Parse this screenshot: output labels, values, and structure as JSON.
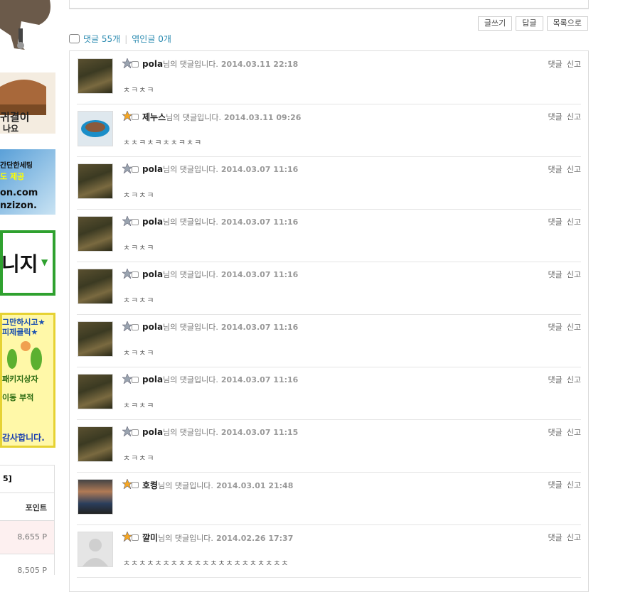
{
  "sidebar": {
    "banner2_text": "귀결이",
    "banner2_sub": "나요",
    "banner3_lines": [
      "간단한세팅",
      "도 제공",
      "on.com",
      "nzizon."
    ],
    "banner4_text": "니지",
    "banner5_lines": [
      "그만하시고★",
      "피제클릭★",
      "패키지상자",
      "이동 부적",
      "감사합니다."
    ],
    "rank_title": "5]",
    "rank_header": "포인트",
    "rank_values": [
      "8,655 P",
      "8,505 P"
    ]
  },
  "toolbar": {
    "write": "글쓰기",
    "reply": "답글",
    "list": "목록으로"
  },
  "comments_header": {
    "comments": "댓글 55개",
    "trackbacks": "엮인글 0개"
  },
  "comment_suffix": "님의 댓글입니다.",
  "comment_actions": {
    "reply": "댓글",
    "report": "신고"
  },
  "comments": [
    {
      "name": "pola",
      "date": "2014.03.11 22:18",
      "text": "ㅊㅋㅊㅋ",
      "avatar": "game"
    },
    {
      "name": "제누스",
      "date": "2014.03.11 09:26",
      "text": "ㅊㅊㅋㅊㅋㅊㅊㅋㅊㅋ",
      "avatar": "cup"
    },
    {
      "name": "pola",
      "date": "2014.03.07 11:16",
      "text": "ㅊㅋㅊㅋ",
      "avatar": "game"
    },
    {
      "name": "pola",
      "date": "2014.03.07 11:16",
      "text": "ㅊㅋㅊㅋ",
      "avatar": "game"
    },
    {
      "name": "pola",
      "date": "2014.03.07 11:16",
      "text": "ㅊㅋㅊㅋ",
      "avatar": "game"
    },
    {
      "name": "pola",
      "date": "2014.03.07 11:16",
      "text": "ㅊㅋㅊㅋ",
      "avatar": "game"
    },
    {
      "name": "pola",
      "date": "2014.03.07 11:16",
      "text": "ㅊㅋㅊㅋ",
      "avatar": "game"
    },
    {
      "name": "pola",
      "date": "2014.03.07 11:15",
      "text": "ㅊㅋㅊㅋ",
      "avatar": "game"
    },
    {
      "name": "호켱",
      "date": "2014.03.01 21:48",
      "text": "",
      "avatar": "person"
    },
    {
      "name": "깔미",
      "date": "2014.02.26 17:37",
      "text": "ㅊㅊㅊㅊㅊㅊㅊㅊㅊㅊㅊㅊㅊㅊㅊㅊㅊㅊㅊㅊㅊ",
      "avatar": "blank"
    }
  ]
}
